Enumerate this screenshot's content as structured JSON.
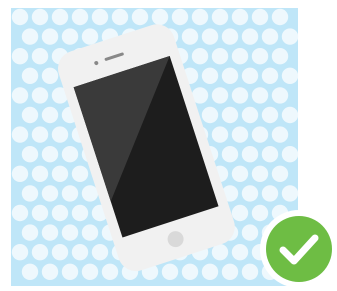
{
  "illustration": {
    "subject": "smartphone-on-bubble-wrap",
    "icons": [
      "phone-icon",
      "check-icon"
    ],
    "colors": {
      "background": "#ffffff",
      "bubble_wrap": "#bfe6f8",
      "bubble": "#eef8fd",
      "phone_body": "#f1f1f1",
      "phone_screen": "#1d1d1d",
      "screen_glare": "#3a3a3a",
      "home_button": "#d9d9d9",
      "check_badge": "#6ebd44",
      "check_mark": "#ffffff"
    }
  }
}
